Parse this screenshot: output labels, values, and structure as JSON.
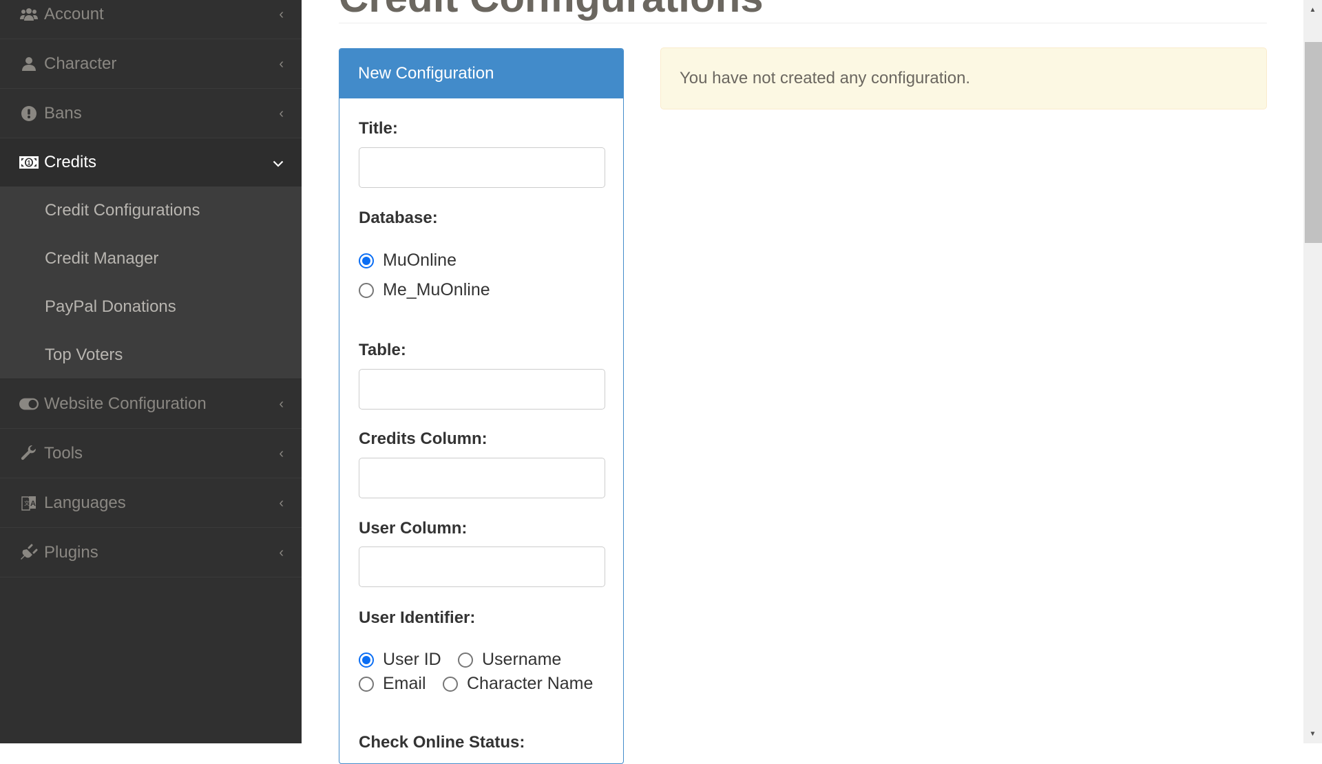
{
  "sidebar": {
    "items": [
      {
        "label": "Account",
        "icon": "users-icon"
      },
      {
        "label": "Character",
        "icon": "user-icon"
      },
      {
        "label": "Bans",
        "icon": "exclamation-circle-icon"
      },
      {
        "label": "Credits",
        "icon": "money-bill-icon",
        "active": true
      },
      {
        "label": "Website Configuration",
        "icon": "toggle-icon"
      },
      {
        "label": "Tools",
        "icon": "wrench-icon"
      },
      {
        "label": "Languages",
        "icon": "language-icon"
      },
      {
        "label": "Plugins",
        "icon": "plug-icon"
      }
    ],
    "credits_submenu": [
      {
        "label": "Credit Configurations"
      },
      {
        "label": "Credit Manager"
      },
      {
        "label": "PayPal Donations"
      },
      {
        "label": "Top Voters"
      }
    ],
    "collapsed_chevron": "‹",
    "expanded_chevron": "⌄"
  },
  "page": {
    "title": "Credit Configurations"
  },
  "form": {
    "header": "New Configuration",
    "title_label": "Title:",
    "title_value": "",
    "database_label": "Database:",
    "database_options": [
      {
        "label": "MuOnline",
        "checked": true
      },
      {
        "label": "Me_MuOnline",
        "checked": false
      }
    ],
    "table_label": "Table:",
    "table_value": "",
    "credits_column_label": "Credits Column:",
    "credits_column_value": "",
    "user_column_label": "User Column:",
    "user_column_value": "",
    "user_identifier_label": "User Identifier:",
    "user_identifier_options": [
      {
        "label": "User ID",
        "checked": true
      },
      {
        "label": "Username",
        "checked": false
      },
      {
        "label": "Email",
        "checked": false
      },
      {
        "label": "Character Name",
        "checked": false
      }
    ],
    "check_online_label": "Check Online Status:"
  },
  "alert": {
    "message": "You have not created any configuration."
  },
  "colors": {
    "sidebar_bg": "#303030",
    "submenu_bg": "#3d3d3d",
    "card_primary": "#428bca",
    "alert_bg": "#fcf8e3",
    "radio_accent": "#0b6ef4"
  }
}
